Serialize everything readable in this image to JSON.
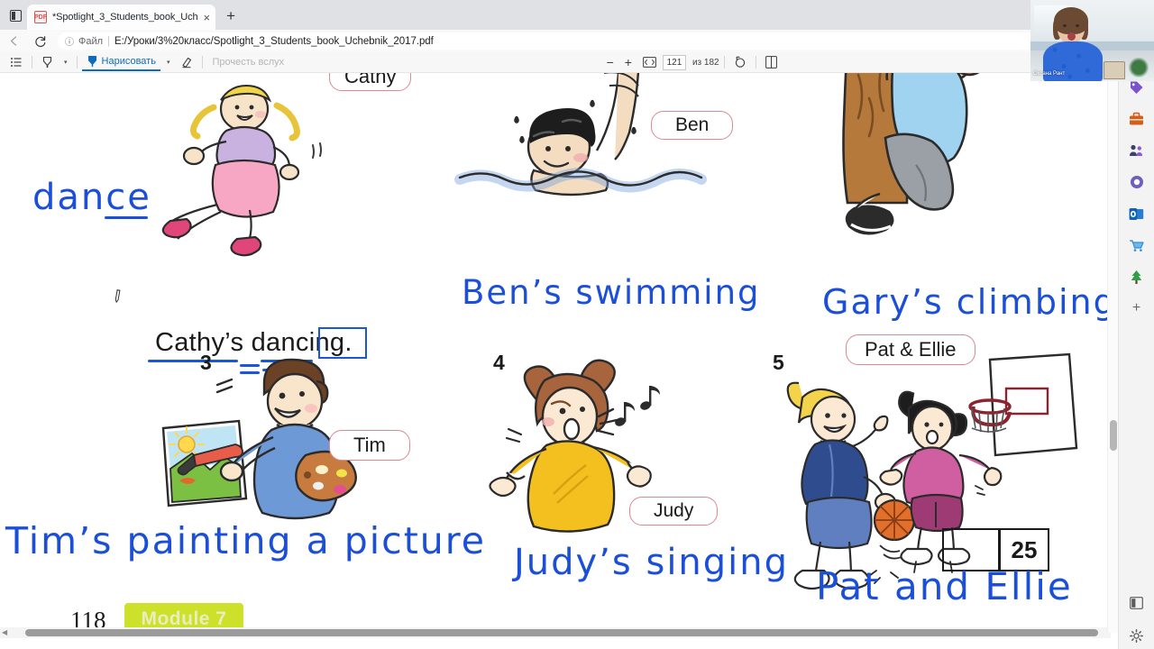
{
  "browser": {
    "tab": {
      "title": "*Spotlight_3_Students_book_Uch",
      "favicon_name": "pdf-file-icon",
      "close_label": "×",
      "new_tab_label": "+"
    },
    "window_button_label": "▣",
    "nav": {
      "back_label": "←",
      "reload_label": "↻",
      "info_label": "ⓘ",
      "scheme_label": "Файл",
      "separator": "|",
      "url": "E:/Уроки/3%20класс/Spotlight_3_Students_book_Uchebnik_2017.pdf"
    },
    "omnibox_right_icons": [
      {
        "name": "zoom-icon",
        "glyph": "⌕"
      },
      {
        "name": "favorites-star-icon",
        "glyph": "☆"
      },
      {
        "name": "extension-red-icon",
        "glyph": ""
      },
      {
        "name": "collections-icon",
        "glyph": "◔"
      }
    ]
  },
  "pdf_toolbar": {
    "contents_icon": "table-of-contents-icon",
    "highlight_label": "",
    "highlight_icon": "highlighter-icon",
    "draw_label": "Нарисовать",
    "draw_icon": "pen-icon",
    "erase_icon": "eraser-icon",
    "read_aloud_label": "Прочесть вслух",
    "zoom_out_label": "−",
    "zoom_in_label": "+",
    "fit_label": "⬚",
    "current_page": "121",
    "page_total_label": "из 182",
    "rotate_icon": "rotate-icon",
    "layout_icon": "page-layout-icon",
    "search_icon": "search-icon",
    "print_icon": "print-icon",
    "caret": "▾"
  },
  "sidebar": {
    "items": [
      {
        "name": "sidebar-deals-icon",
        "glyph": "◆",
        "color": "#7a52cc"
      },
      {
        "name": "sidebar-briefcase-icon",
        "glyph": "▬",
        "color": "#d2601a"
      },
      {
        "name": "sidebar-contacts-icon",
        "glyph": "☻",
        "color": "#4c4f8a"
      },
      {
        "name": "sidebar-circle-icon",
        "glyph": "◉",
        "color": "#6f5fbd"
      },
      {
        "name": "sidebar-outlook-icon",
        "glyph": "✉",
        "color": "#1a7fd4"
      },
      {
        "name": "sidebar-shopping-cart-icon",
        "glyph": "▼",
        "color": "#2f8fd1"
      },
      {
        "name": "sidebar-tree-icon",
        "glyph": "♣",
        "color": "#2f9e44"
      },
      {
        "name": "sidebar-add-icon",
        "glyph": "+",
        "color": "#6a6a6a"
      }
    ],
    "bottom_items": [
      {
        "name": "split-screen-icon",
        "glyph": "◫",
        "color": "#5b5b5b"
      },
      {
        "name": "settings-gear-icon",
        "glyph": "⚙",
        "color": "#5b5b5b"
      }
    ]
  },
  "webcam": {
    "participant_name": "Оксана Рант"
  },
  "document": {
    "page_number": "118",
    "module_label": "Module 7",
    "exercise_box_number": "25",
    "cursor_tool": "pencil-cursor",
    "items": [
      {
        "number": "",
        "prompt_word": "dance",
        "name_pill": "Cathy",
        "printed_sentence": "Cathy’s dancing.",
        "handwriting": "",
        "illustration": "girl-dancing"
      },
      {
        "number": "",
        "prompt_word": "",
        "name_pill": "Ben",
        "printed_sentence": "",
        "handwriting": "Ben’s  swimming",
        "illustration": "boy-swimming"
      },
      {
        "number": "",
        "prompt_word": "",
        "name_pill": "",
        "printed_sentence": "",
        "handwriting": "Gary’s climbing",
        "illustration": "boy-climbing-tree"
      },
      {
        "number": "3",
        "prompt_word": "",
        "name_pill": "Tim",
        "printed_sentence": "",
        "handwriting": "Tim’s painting  a picture",
        "illustration": "boy-painting"
      },
      {
        "number": "4",
        "prompt_word": "",
        "name_pill": "Judy",
        "printed_sentence": "",
        "handwriting": "Judy’s singing",
        "illustration": "girl-singing"
      },
      {
        "number": "5",
        "prompt_word": "",
        "name_pill": "Pat & Ellie",
        "printed_sentence": "",
        "handwriting": "Pat and Ellie",
        "illustration": "girls-basketball"
      }
    ]
  },
  "colors": {
    "ink_blue": "#1b4fd8",
    "pill_border": "#d98a93",
    "module_badge": "#cde02a",
    "accent": "#0f6cbd"
  }
}
